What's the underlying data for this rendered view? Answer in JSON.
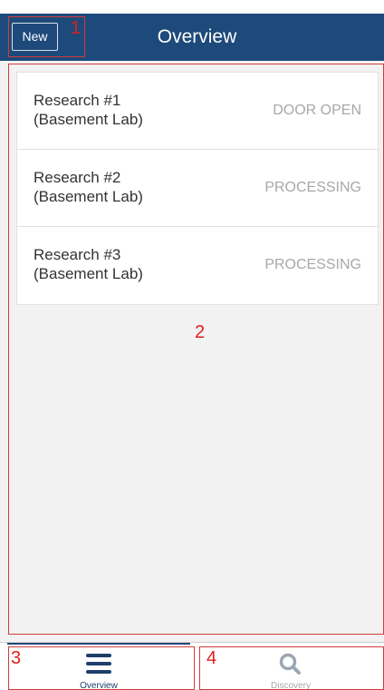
{
  "header": {
    "new_label": "New",
    "title": "Overview",
    "bg_color": "#1d4a7a"
  },
  "annotations": [
    "1",
    "2",
    "3",
    "4"
  ],
  "research_list": [
    {
      "name_line1": "Research #1",
      "name_line2": "(Basement Lab)",
      "status": "DOOR OPEN"
    },
    {
      "name_line1": "Research #2",
      "name_line2": "(Basement Lab)",
      "status": "PROCESSING"
    },
    {
      "name_line1": "Research #3",
      "name_line2": "(Basement Lab)",
      "status": "PROCESSING"
    }
  ],
  "tabs": [
    {
      "label": "Overview",
      "icon": "menu-icon",
      "active": true
    },
    {
      "label": "Discovery",
      "icon": "search-icon",
      "active": false
    }
  ],
  "colors": {
    "accent": "#1d4a7a",
    "annotation": "#e01e1e",
    "status_text": "#a8a8a8"
  }
}
